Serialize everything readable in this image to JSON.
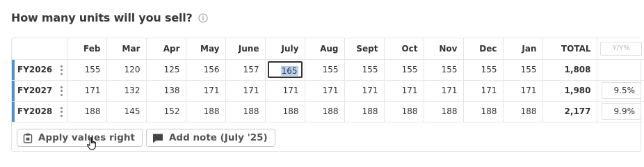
{
  "header": {
    "title": "How many units will you sell?"
  },
  "table": {
    "months": [
      "Feb",
      "Mar",
      "Apr",
      "May",
      "June",
      "July",
      "Aug",
      "Sept",
      "Oct",
      "Nov",
      "Dec",
      "Jan"
    ],
    "total_label": "TOTAL",
    "yy_label": "Y/Y%",
    "rows": [
      {
        "label": "FY2026",
        "values": [
          "155",
          "120",
          "125",
          "156",
          "157",
          "165",
          "155",
          "155",
          "155",
          "155",
          "155",
          "155"
        ],
        "total": "1,808",
        "yy": ""
      },
      {
        "label": "FY2027",
        "values": [
          "171",
          "132",
          "138",
          "171",
          "171",
          "171",
          "171",
          "171",
          "171",
          "171",
          "171",
          "171"
        ],
        "total": "1,980",
        "yy": "9.5%"
      },
      {
        "label": "FY2028",
        "values": [
          "188",
          "145",
          "152",
          "188",
          "188",
          "188",
          "188",
          "188",
          "188",
          "188",
          "188",
          "188"
        ],
        "total": "2,177",
        "yy": "9.9%"
      }
    ]
  },
  "actions": {
    "apply_label": "Apply values right",
    "note_label": "Add note (July '25)"
  },
  "colors": {
    "accent": "#4a90d9",
    "selection": "#b9d3f3"
  }
}
